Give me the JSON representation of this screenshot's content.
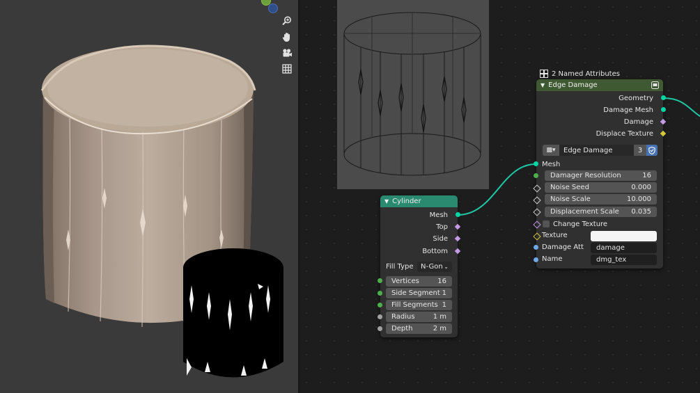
{
  "colors": {
    "link": "#1fc7a4",
    "geometry_socket": "#00d6a3",
    "attribute_socket": "#c59be6",
    "texture_socket": "#d5c63a",
    "value_socket": "#a1a1a1",
    "string_socket": "#6fa8e8",
    "cylinder_header": "#2a8a6f",
    "group_header": "#3f5a32"
  },
  "viewport": {
    "tools": [
      "zoom-icon",
      "hand-pan-icon",
      "camera-icon",
      "grid-icon"
    ]
  },
  "named_attributes": {
    "label": "2 Named Attributes"
  },
  "edge_damage_node": {
    "title": "Edge Damage",
    "outputs": [
      "Geometry",
      "Damage Mesh",
      "Damage",
      "Displace Texture"
    ],
    "group": {
      "name": "Edge Damage",
      "users": "3"
    },
    "mesh_input": "Mesh",
    "params": [
      {
        "label": "Damager Resolution",
        "value": "16"
      },
      {
        "label": "Noise Seed",
        "value": "0.000"
      },
      {
        "label": "Noise Scale",
        "value": "10.000"
      },
      {
        "label": "Displacement Scale",
        "value": "0.035"
      }
    ],
    "change_texture": "Change Texture",
    "texture_label": "Texture",
    "damage_att_label": "Damage Att",
    "damage_att_value": "damage",
    "name_label": "Name",
    "name_value": "dmg_tex"
  },
  "cylinder_node": {
    "title": "Cylinder",
    "outputs": [
      "Mesh",
      "Top",
      "Side",
      "Bottom"
    ],
    "fill_type_label": "Fill Type",
    "fill_type_value": "N-Gon",
    "params": [
      {
        "label": "Vertices",
        "value": "16"
      },
      {
        "label": "Side Segment",
        "value": "1"
      },
      {
        "label": "Fill Segments",
        "value": "1"
      },
      {
        "label": "Radius",
        "value": "1 m"
      },
      {
        "label": "Depth",
        "value": "2 m"
      }
    ]
  }
}
